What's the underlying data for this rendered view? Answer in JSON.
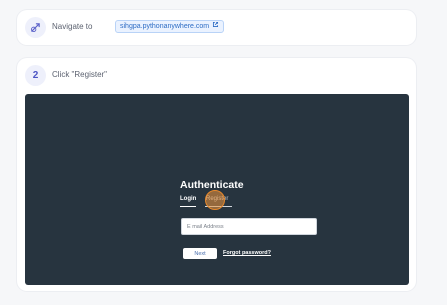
{
  "steps": [
    {
      "label": "Navigate to",
      "url": "sihgpa.pythonanywhere.com",
      "icon": "navigate-icon"
    },
    {
      "number": "2",
      "label": "Click \"Register\""
    }
  ],
  "screen": {
    "title": "Authenticate",
    "tabs": [
      {
        "label": "Login",
        "active": true
      },
      {
        "label": "Register",
        "active": false
      }
    ],
    "email_placeholder": "E mail Address",
    "next_label": "Next",
    "forgot_label": "Forgot password?"
  },
  "colors": {
    "accent": "#4c54c4",
    "screen_bg": "#27343f",
    "url_chip_text": "#2d6cc4",
    "click_marker": "#e8892c"
  }
}
